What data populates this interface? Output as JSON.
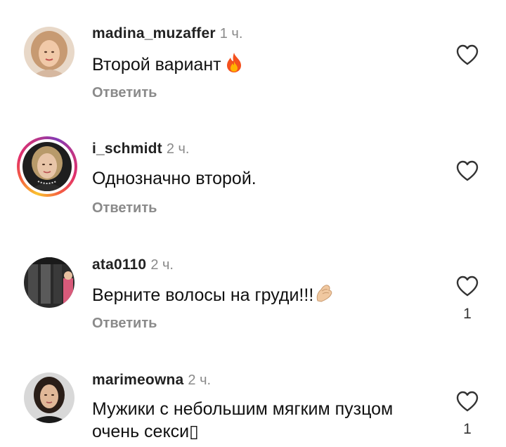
{
  "comments": [
    {
      "username": "madina_muzaffer",
      "time": "1 ч.",
      "text": "Второй вариант",
      "emoji": "fire",
      "reply_label": "Ответить",
      "likes": "",
      "icon": "heart-outline-icon"
    },
    {
      "username": "i_schmidt",
      "time": "2 ч.",
      "text": "Однозначно второй.",
      "emoji": "",
      "reply_label": "Ответить",
      "likes": "",
      "icon": "heart-outline-icon",
      "story_ring": true
    },
    {
      "username": "ata0110",
      "time": "2 ч.",
      "text": "Верните волосы на груди!!!",
      "emoji": "pinched-fingers",
      "reply_label": "Ответить",
      "likes": "1",
      "icon": "heart-outline-icon"
    },
    {
      "username": "marimeowna",
      "time": "2 ч.",
      "text": "Мужики с небольшим мягким пузцом очень секси▯",
      "emoji": "",
      "reply_label": "",
      "likes": "1",
      "icon": "heart-outline-icon"
    }
  ],
  "colors": {
    "text": "#111111",
    "secondary": "#8a8a8a",
    "fire": "#f4511e",
    "ring_start": "#f9c22e",
    "ring_end": "#c13584"
  }
}
